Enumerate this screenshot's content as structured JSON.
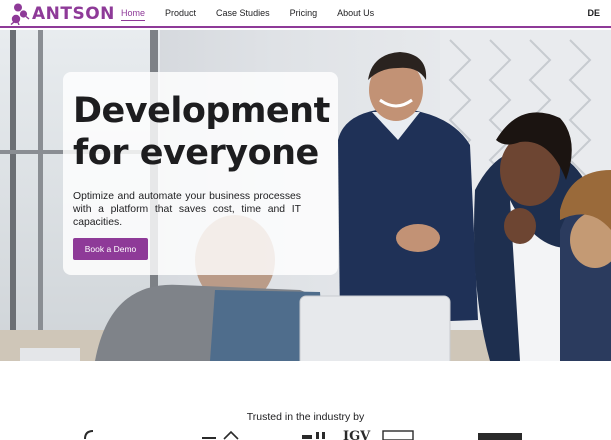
{
  "brand": {
    "name": "ANTSON",
    "color": "#8e3a98"
  },
  "nav": {
    "items": [
      {
        "label": "Home",
        "active": true
      },
      {
        "label": "Product",
        "active": false
      },
      {
        "label": "Case Studies",
        "active": false
      },
      {
        "label": "Pricing",
        "active": false
      },
      {
        "label": "About Us",
        "active": false
      }
    ],
    "language": "DE"
  },
  "hero": {
    "title_line1": "Development",
    "title_line2": "for everyone",
    "description": "Optimize and automate your business processes with a platform that saves cost, time and IT capacities.",
    "cta_label": "Book a Demo",
    "image": "team-collaboration-photo"
  },
  "trust": {
    "heading": "Trusted in the industry by",
    "partner_logos": [
      "partner-logo-1",
      "partner-logo-2",
      "partner-logo-3",
      "partner-logo-4",
      "partner-logo-5"
    ]
  }
}
